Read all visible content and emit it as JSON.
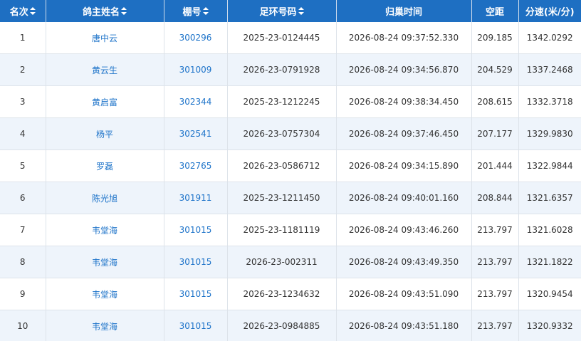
{
  "headers": [
    {
      "key": "rank",
      "label": "名次",
      "sortable": true
    },
    {
      "key": "owner",
      "label": "鸽主姓名",
      "sortable": true
    },
    {
      "key": "loft",
      "label": "棚号",
      "sortable": true
    },
    {
      "key": "ring",
      "label": "足环号码",
      "sortable": true
    },
    {
      "key": "arrival",
      "label": "归巢时间",
      "sortable": false
    },
    {
      "key": "distance",
      "label": "空距",
      "sortable": false
    },
    {
      "key": "speed",
      "label": "分速(米/分)",
      "sortable": false
    }
  ],
  "rows": [
    {
      "rank": "1",
      "owner": "唐中云",
      "loft": "300296",
      "ring": "2025-23-0124445",
      "arrival": "2026-08-24 09:37:52.330",
      "distance": "209.185",
      "speed": "1342.0292"
    },
    {
      "rank": "2",
      "owner": "黄云生",
      "loft": "301009",
      "ring": "2026-23-0791928",
      "arrival": "2026-08-24 09:34:56.870",
      "distance": "204.529",
      "speed": "1337.2468"
    },
    {
      "rank": "3",
      "owner": "黄启富",
      "loft": "302344",
      "ring": "2025-23-1212245",
      "arrival": "2026-08-24 09:38:34.450",
      "distance": "208.615",
      "speed": "1332.3718"
    },
    {
      "rank": "4",
      "owner": "杨平",
      "loft": "302541",
      "ring": "2026-23-0757304",
      "arrival": "2026-08-24 09:37:46.450",
      "distance": "207.177",
      "speed": "1329.9830"
    },
    {
      "rank": "5",
      "owner": "罗磊",
      "loft": "302765",
      "ring": "2026-23-0586712",
      "arrival": "2026-08-24 09:34:15.890",
      "distance": "201.444",
      "speed": "1322.9844"
    },
    {
      "rank": "6",
      "owner": "陈光旭",
      "loft": "301911",
      "ring": "2025-23-1211450",
      "arrival": "2026-08-24 09:40:01.160",
      "distance": "208.844",
      "speed": "1321.6357"
    },
    {
      "rank": "7",
      "owner": "韦堂海",
      "loft": "301015",
      "ring": "2025-23-1181119",
      "arrival": "2026-08-24 09:43:46.260",
      "distance": "213.797",
      "speed": "1321.6028"
    },
    {
      "rank": "8",
      "owner": "韦堂海",
      "loft": "301015",
      "ring": "2026-23-002311",
      "arrival": "2026-08-24 09:43:49.350",
      "distance": "213.797",
      "speed": "1321.1822"
    },
    {
      "rank": "9",
      "owner": "韦堂海",
      "loft": "301015",
      "ring": "2026-23-1234632",
      "arrival": "2026-08-24 09:43:51.090",
      "distance": "213.797",
      "speed": "1320.9454"
    },
    {
      "rank": "10",
      "owner": "韦堂海",
      "loft": "301015",
      "ring": "2026-23-0984885",
      "arrival": "2026-08-24 09:43:51.180",
      "distance": "213.797",
      "speed": "1320.9332"
    }
  ]
}
